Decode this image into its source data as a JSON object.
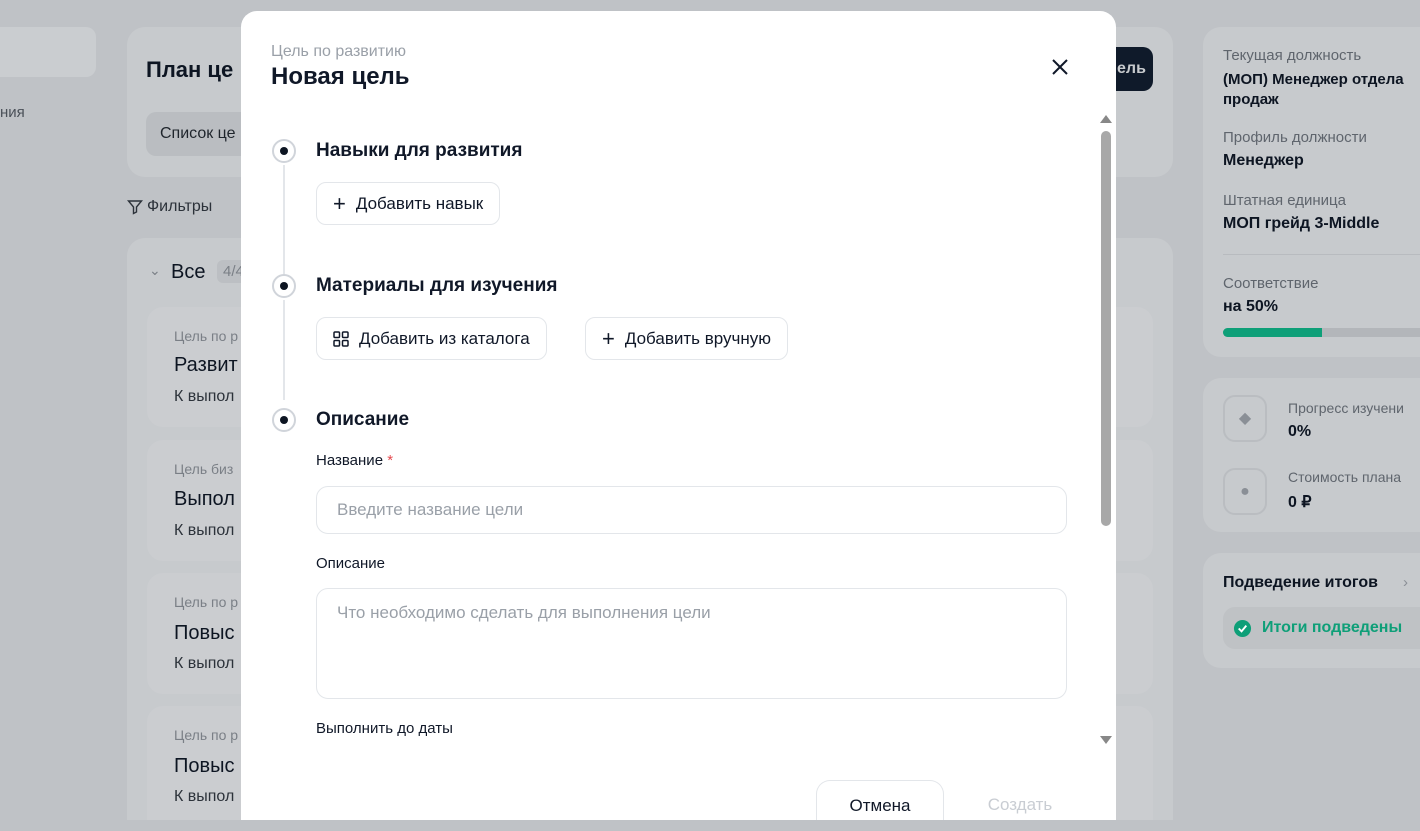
{
  "background": {
    "sidebar_fragment": "ния",
    "plan_title": "План це",
    "tab_list": "Список це",
    "create_goal_button": "ель",
    "filters": "Фильтры",
    "group_label": "Все",
    "group_count": "4/4",
    "goals": [
      {
        "kind": "Цель по р",
        "title": "Развит",
        "status": "К выпол"
      },
      {
        "kind": "Цель биз",
        "title": "Выпол",
        "status": "К выпол"
      },
      {
        "kind": "Цель по р",
        "title": "Повыс",
        "status": "К выпол"
      },
      {
        "kind": "Цель по р",
        "title": "Повыс",
        "status": "К выпол"
      }
    ],
    "right_panel": {
      "current_position_label": "Текущая должность",
      "current_position_value": "(МОП) Менеджер отдела продаж",
      "profile_label": "Профиль должности",
      "profile_value": "Менеджер",
      "staff_unit_label": "Штатная единица",
      "staff_unit_value": "МОП грейд 3-Middle",
      "match_label": "Соответствие",
      "match_value": "на 50%",
      "match_percent": 50,
      "progress_label": "Прогресс изучени",
      "progress_value": "0%",
      "cost_label": "Стоимость плана",
      "cost_value": "0 ₽",
      "summary_title": "Подведение итогов",
      "summary_status": "Итоги подведены",
      "accent_color": "#0e9f78"
    }
  },
  "modal": {
    "subtitle": "Цель по развитию",
    "title": "Новая цель",
    "steps": [
      {
        "heading": "Навыки для развития"
      },
      {
        "heading": "Материалы для изучения"
      },
      {
        "heading": "Описание"
      }
    ],
    "add_skill": "Добавить навык",
    "add_from_catalog": "Добавить из каталога",
    "add_manually": "Добавить вручную",
    "name_label": "Название",
    "required_mark": "*",
    "name_placeholder": "Введите название цели",
    "description_label": "Описание",
    "description_placeholder": "Что необходимо сделать для выполнения цели",
    "due_date_label": "Выполнить до даты",
    "cancel": "Отмена",
    "create": "Создать"
  }
}
